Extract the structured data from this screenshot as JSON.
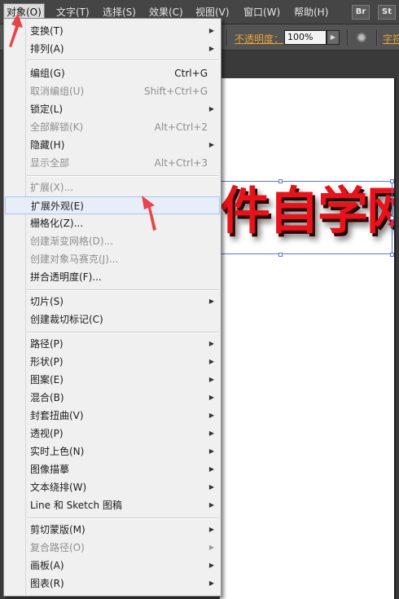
{
  "menubar": {
    "items": [
      "对象(O)",
      "文字(T)",
      "选择(S)",
      "效果(C)",
      "视图(V)",
      "窗口(W)",
      "帮助(H)"
    ],
    "bridge_label": "Br",
    "stock_label": "St"
  },
  "controlbar": {
    "opacity_label": "不透明度：",
    "opacity_value": "100%",
    "char_label": "字符"
  },
  "artboard": {
    "text": "件自学网",
    "text_color": "#e8121a"
  },
  "menu": {
    "items": [
      {
        "label": "变换(T)",
        "shortcut": "",
        "submenu": true,
        "disabled": false
      },
      {
        "label": "排列(A)",
        "shortcut": "",
        "submenu": true,
        "disabled": false
      },
      {
        "label": "编组(G)",
        "shortcut": "Ctrl+G",
        "submenu": false,
        "disabled": false
      },
      {
        "label": "取消编组(U)",
        "shortcut": "Shift+Ctrl+G",
        "submenu": false,
        "disabled": true
      },
      {
        "label": "锁定(L)",
        "shortcut": "",
        "submenu": true,
        "disabled": false
      },
      {
        "label": "全部解锁(K)",
        "shortcut": "Alt+Ctrl+2",
        "submenu": false,
        "disabled": true
      },
      {
        "label": "隐藏(H)",
        "shortcut": "",
        "submenu": true,
        "disabled": false
      },
      {
        "label": "显示全部",
        "shortcut": "Alt+Ctrl+3",
        "submenu": false,
        "disabled": true
      },
      {
        "label": "扩展(X)...",
        "shortcut": "",
        "submenu": false,
        "disabled": true
      },
      {
        "label": "扩展外观(E)",
        "shortcut": "",
        "submenu": false,
        "disabled": false,
        "highlighted": true
      },
      {
        "label": "栅格化(Z)...",
        "shortcut": "",
        "submenu": false,
        "disabled": false
      },
      {
        "label": "创建渐变网格(D)...",
        "shortcut": "",
        "submenu": false,
        "disabled": true
      },
      {
        "label": "创建对象马赛克(J)...",
        "shortcut": "",
        "submenu": false,
        "disabled": true
      },
      {
        "label": "拼合透明度(F)...",
        "shortcut": "",
        "submenu": false,
        "disabled": false
      },
      {
        "label": "切片(S)",
        "shortcut": "",
        "submenu": true,
        "disabled": false
      },
      {
        "label": "创建裁切标记(C)",
        "shortcut": "",
        "submenu": false,
        "disabled": false
      },
      {
        "label": "路径(P)",
        "shortcut": "",
        "submenu": true,
        "disabled": false
      },
      {
        "label": "形状(P)",
        "shortcut": "",
        "submenu": true,
        "disabled": false
      },
      {
        "label": "图案(E)",
        "shortcut": "",
        "submenu": true,
        "disabled": false
      },
      {
        "label": "混合(B)",
        "shortcut": "",
        "submenu": true,
        "disabled": false
      },
      {
        "label": "封套扭曲(V)",
        "shortcut": "",
        "submenu": true,
        "disabled": false
      },
      {
        "label": "透视(P)",
        "shortcut": "",
        "submenu": true,
        "disabled": false
      },
      {
        "label": "实时上色(N)",
        "shortcut": "",
        "submenu": true,
        "disabled": false
      },
      {
        "label": "图像描摹",
        "shortcut": "",
        "submenu": true,
        "disabled": false
      },
      {
        "label": "文本绕排(W)",
        "shortcut": "",
        "submenu": true,
        "disabled": false
      },
      {
        "label": "Line 和 Sketch 图稿",
        "shortcut": "",
        "submenu": true,
        "disabled": false
      },
      {
        "label": "剪切蒙版(M)",
        "shortcut": "",
        "submenu": true,
        "disabled": false
      },
      {
        "label": "复合路径(O)",
        "shortcut": "",
        "submenu": true,
        "disabled": true
      },
      {
        "label": "画板(A)",
        "shortcut": "",
        "submenu": true,
        "disabled": false
      },
      {
        "label": "图表(R)",
        "shortcut": "",
        "submenu": true,
        "disabled": false
      }
    ]
  },
  "annotation_color": "#e8454a"
}
